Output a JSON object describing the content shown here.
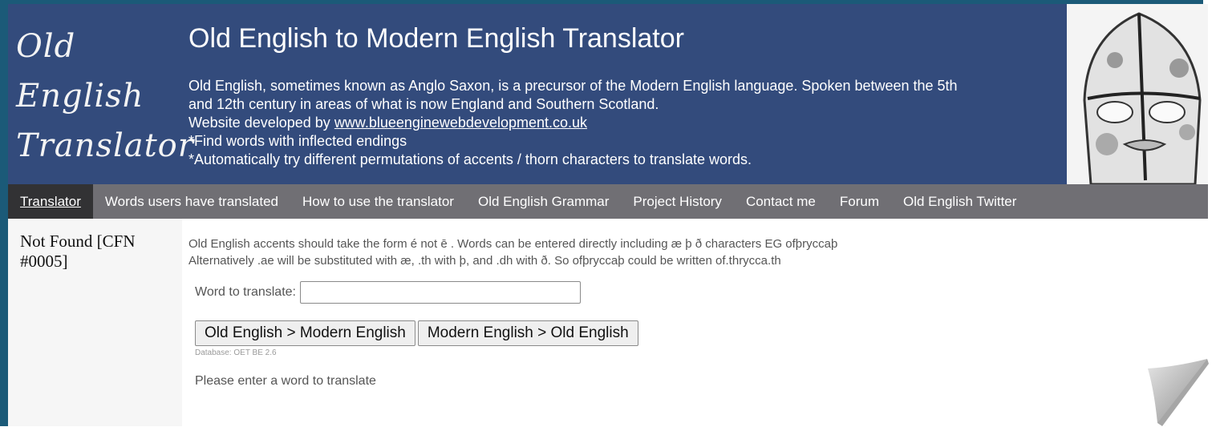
{
  "header": {
    "logo_line1": "Old English",
    "logo_line2": "Translator",
    "title": "Old English to Modern English Translator",
    "description_line1": "Old English, sometimes known as Anglo Saxon, is a precursor of the Modern English language. Spoken between the 5th",
    "description_line2": "and 12th century in areas of what is now England and Southern Scotland.",
    "developer_prefix": "Website developed by",
    "developer_link": "www.blueenginewebdevelopment.co.uk",
    "feature1": "*Find words with inflected endings",
    "feature2": "*Automatically try different permutations of accents / thorn characters to translate words.",
    "image": "anglo-saxon-helmet-sketch"
  },
  "nav": {
    "items": [
      {
        "label": "Translator",
        "active": true
      },
      {
        "label": "Words users have translated"
      },
      {
        "label": "How to use the translator"
      },
      {
        "label": "Old English Grammar"
      },
      {
        "label": "Project History"
      },
      {
        "label": "Contact me"
      },
      {
        "label": "Forum"
      },
      {
        "label": "Old English Twitter"
      }
    ]
  },
  "sidebar": {
    "text": "Not Found [CFN #0005]"
  },
  "main": {
    "info_line1": "Old English accents should take the form é not ē . Words can be entered directly including æ þ ð characters EG ofþryccaþ",
    "info_line2": "Alternatively .ae will be substituted with æ, .th with þ, and .dh with ð. So ofþryccaþ could be written of.thrycca.th",
    "word_label": "Word to translate:",
    "word_value": "",
    "btn_oe_to_me": "Old English > Modern English",
    "btn_me_to_oe": "Modern English > Old English",
    "database": "Database: OET BE 2.6",
    "message": "Please enter a word to translate"
  },
  "colors": {
    "header_bg": "#334b7c",
    "nav_bg": "#706f74",
    "nav_active_bg": "#323234",
    "frame_teal": "#1b5a78"
  }
}
